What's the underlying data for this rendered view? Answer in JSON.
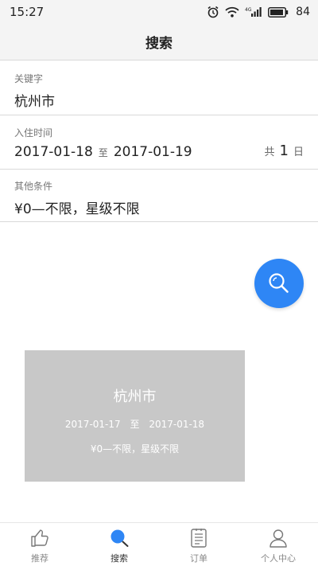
{
  "status_bar": {
    "time": "15:27",
    "network": "4G",
    "battery": "84"
  },
  "header": {
    "title": "搜索"
  },
  "form": {
    "keyword_label": "关键字",
    "keyword_value": "杭州市",
    "date_label": "入住时间",
    "check_in": "2017-01-18",
    "date_separator": "至",
    "check_out": "2017-01-19",
    "nights_prefix": "共",
    "nights_count": "1",
    "nights_suffix": "日",
    "other_label": "其他条件",
    "other_value": "¥0—不限，星级不限"
  },
  "history_card": {
    "city": "杭州市",
    "check_in": "2017-01-17",
    "separator": "至",
    "check_out": "2017-01-18",
    "conditions": "¥0—不限，星级不限"
  },
  "tabs": [
    {
      "label": "推荐",
      "icon": "thumbs-up-icon"
    },
    {
      "label": "搜索",
      "icon": "search-icon"
    },
    {
      "label": "订单",
      "icon": "order-list-icon"
    },
    {
      "label": "个人中心",
      "icon": "user-icon"
    }
  ],
  "colors": {
    "accent": "#2e86f5",
    "card_background": "#c8c8c8",
    "header_background": "#f4f4f4"
  }
}
